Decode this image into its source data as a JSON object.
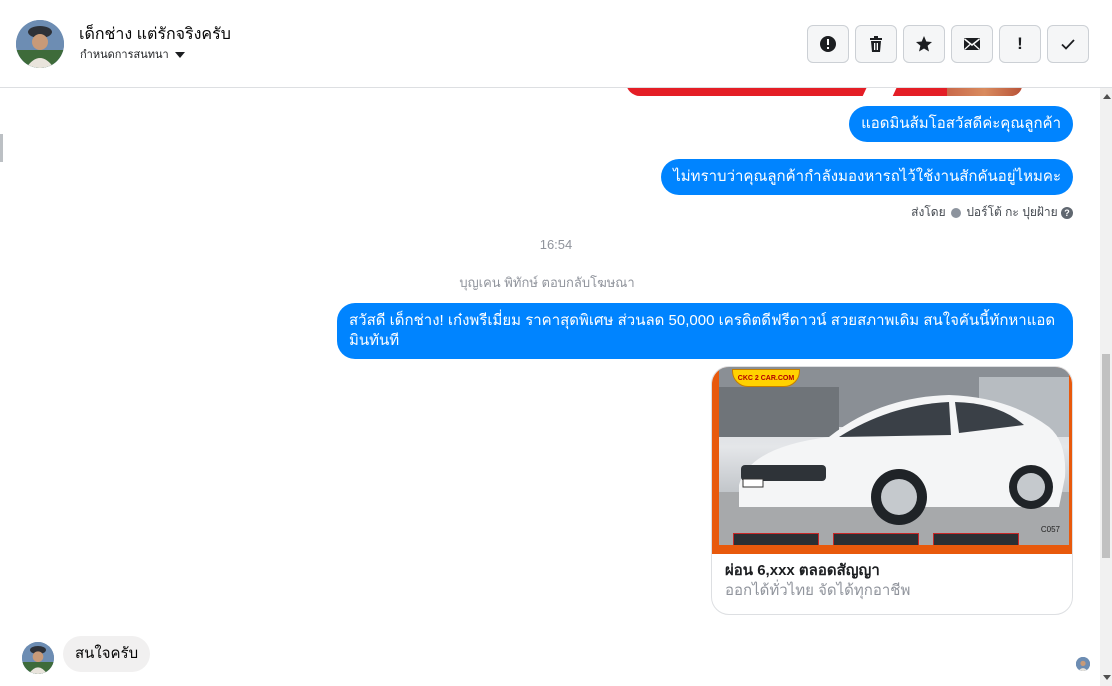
{
  "header": {
    "contact_name": "เด็กช่าง แต่รักจริงครับ",
    "subtitle": "กำหนดการสนทนา"
  },
  "toolbar": {
    "buttons": [
      {
        "name": "spam",
        "icon": "alert-circle-icon"
      },
      {
        "name": "delete",
        "icon": "trash-icon"
      },
      {
        "name": "star",
        "icon": "star-icon"
      },
      {
        "name": "mark-unread",
        "icon": "envelope-icon"
      },
      {
        "name": "follow-up",
        "icon": "exclamation-icon",
        "label": "!"
      },
      {
        "name": "done",
        "icon": "check-icon"
      }
    ]
  },
  "messages": {
    "outgoing_1": "แอดมินส้มโอสวัสดีค่ะคุณลูกค้า",
    "outgoing_2": "ไม่ทราบว่าคุณลูกค้ากำลังมองหารถไว้ใช้งานสักคันอยู่ไหมคะ",
    "sent_by_prefix": "ส่งโดย",
    "sent_by_name": "ปอร์โต้ กะ ปุยฝ้าย",
    "timestamp": "16:54",
    "system_note": "บุญเคน พิทักษ์ ตอบกลับโฆษณา",
    "outgoing_3": "สวัสดี เด็กช่าง! เก๋งพรีเมี่ยม ราคาสุดพิเศษ ส่วนลด 50,000 เครดิตดีฟรีดาวน์ สวยสภาพเดิม สนใจคันนี้ทักหาแอดมินทันที",
    "incoming_1": "สนใจครับ"
  },
  "ad_card": {
    "logo_text": "CKC 2 CAR.COM",
    "code": "C057",
    "title": "ผ่อน 6,xxx ตลอดสัญญา",
    "subtitle": "ออกได้ทั่วไทย จัดได้ทุกอาชีพ"
  },
  "colors": {
    "outgoing_bubble": "#0084ff",
    "incoming_bubble": "#f1f0f0",
    "ad_frame": "#e8590c"
  }
}
